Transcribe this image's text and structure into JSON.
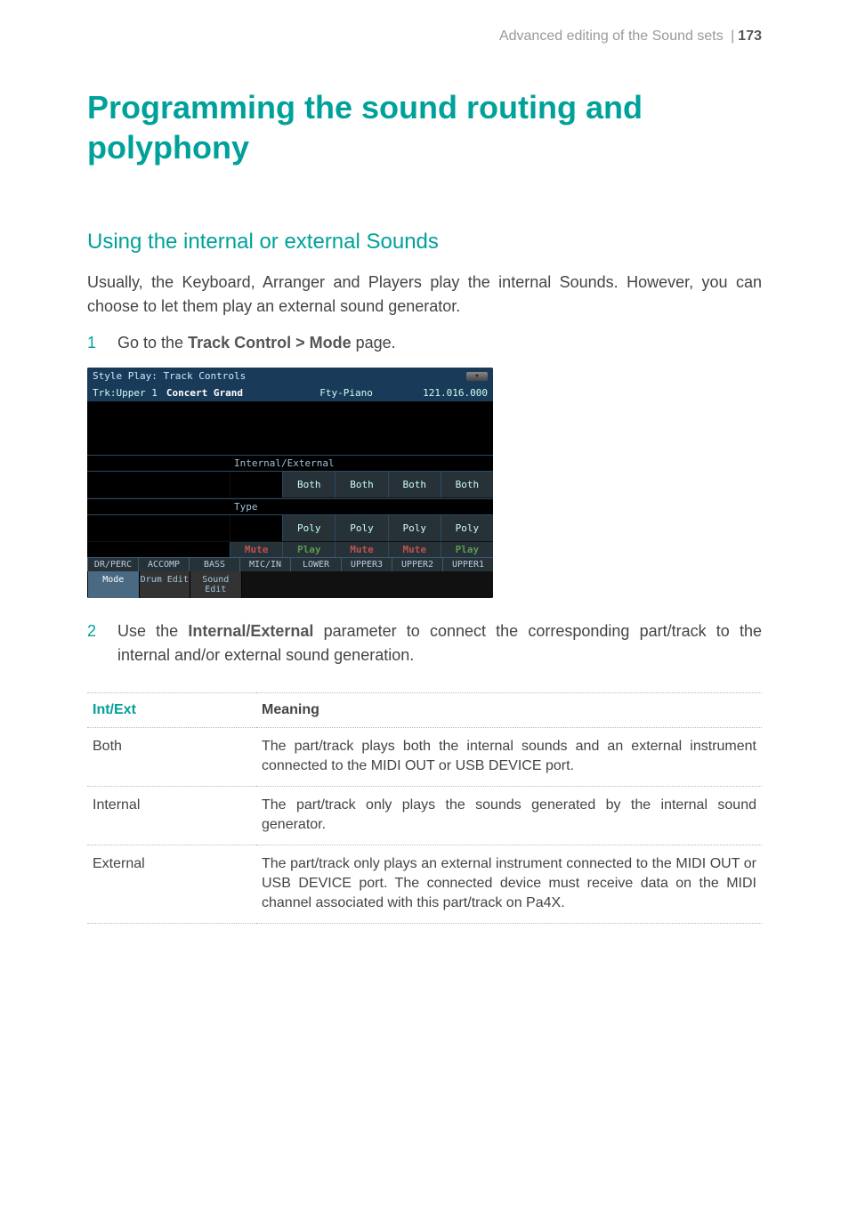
{
  "header": {
    "running": "Advanced editing of the Sound sets",
    "page": "173"
  },
  "title": "Programming the sound routing and polyphony",
  "subsection": "Using the internal or external Sounds",
  "intro": "Usually, the Keyboard, Arranger and Players play the internal Sounds. However, you can choose to let them play an external sound generator.",
  "step1": {
    "num": "1",
    "prefix": "Go to the ",
    "bold": "Track Control > Mode",
    "suffix": " page."
  },
  "step2": {
    "num": "2",
    "prefix": "Use the ",
    "bold": "Internal/External",
    "suffix": " parameter to connect the corresponding part/track to the internal and/or external sound generation."
  },
  "screenshot": {
    "title": "Style Play: Track Controls",
    "trk": "Trk:Upper 1",
    "sound_name": "Concert Grand",
    "bank": "Fty-Piano",
    "num": "121.016.000",
    "section1": "Internal/External",
    "row1": [
      "",
      "Both",
      "Both",
      "Both",
      "Both"
    ],
    "section2": "Type",
    "row2": [
      "",
      "Poly",
      "Poly",
      "Poly",
      "Poly"
    ],
    "mp": [
      "Mute",
      "Play",
      "Mute",
      "Mute",
      "Play"
    ],
    "cols": [
      "DR/PERC",
      "ACCOMP",
      "BASS",
      "MIC/IN",
      "LOWER",
      "UPPER3",
      "UPPER2",
      "UPPER1"
    ],
    "tabs": [
      "Mode",
      "Drum Edit",
      "Sound Edit"
    ]
  },
  "table": {
    "header": [
      "Int/Ext",
      "Meaning"
    ],
    "rows": [
      {
        "k": "Both",
        "v": "The part/track plays both the internal sounds and an external instrument connected to the MIDI OUT or USB DEVICE port."
      },
      {
        "k": "Internal",
        "v": "The part/track only plays the sounds generated by the internal sound generator."
      },
      {
        "k": "External",
        "v": "The part/track only plays an external instrument connected to the MIDI OUT or USB DEVICE port. The connected device must receive data on the MIDI channel associated with this part/track on Pa4X."
      }
    ]
  }
}
